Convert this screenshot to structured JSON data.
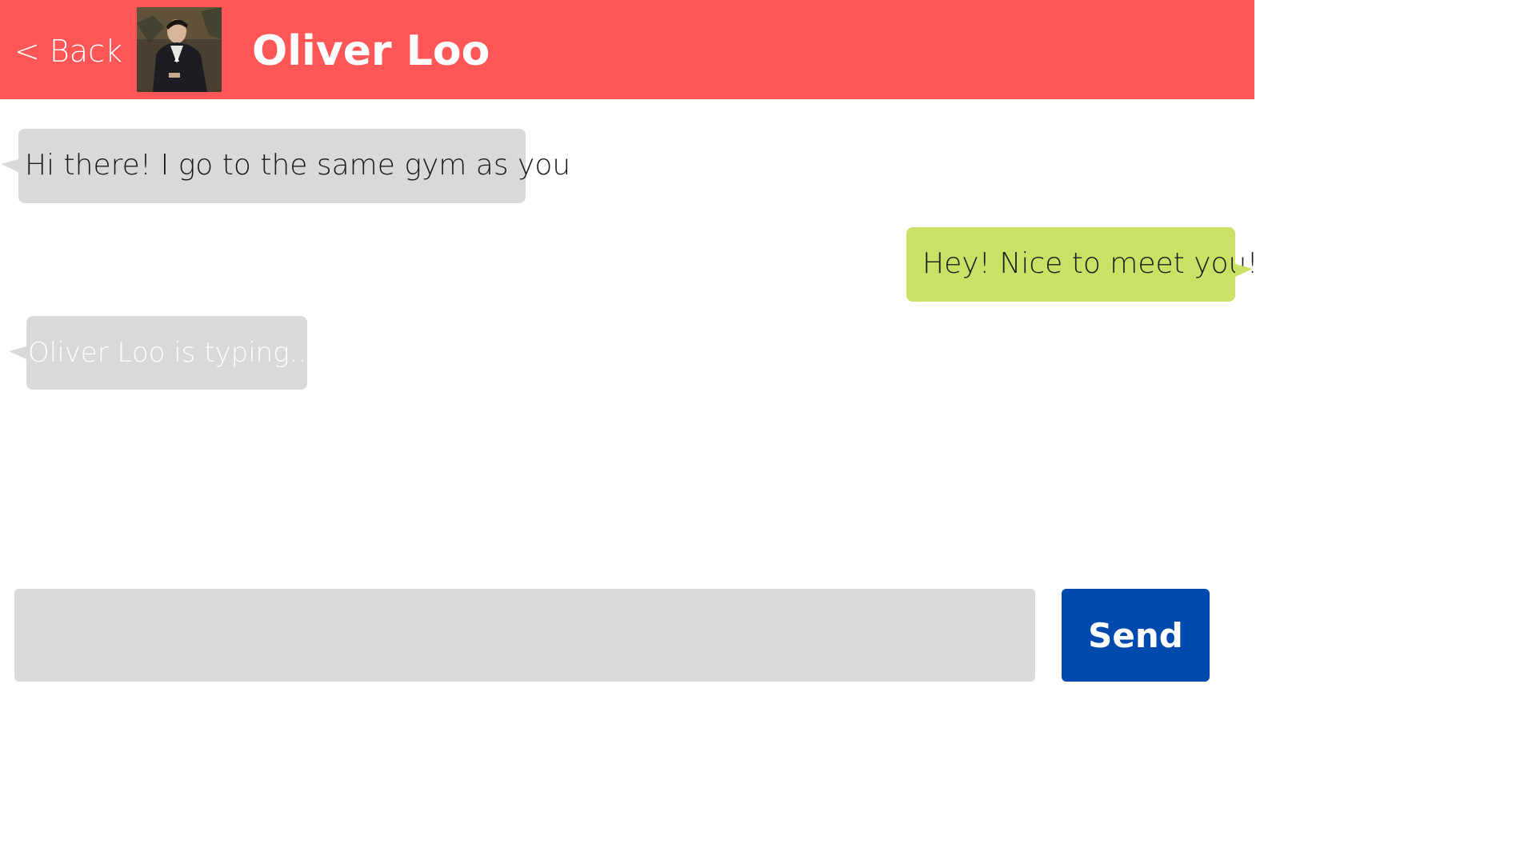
{
  "header": {
    "back_label": "< Back",
    "contact_name": "Oliver Loo",
    "background_color": "#ff5757"
  },
  "messages": [
    {
      "direction": "incoming",
      "text": "Hi there! I go to the same gym as you",
      "color": "#d9d9d9"
    },
    {
      "direction": "outgoing",
      "text": "Hey! Nice to meet you!",
      "color": "#c9e265"
    }
  ],
  "typing_indicator": {
    "text": "Oliver Loo is typing..."
  },
  "composer": {
    "value": "",
    "placeholder": "",
    "send_label": "Send",
    "send_color": "#004aad"
  }
}
